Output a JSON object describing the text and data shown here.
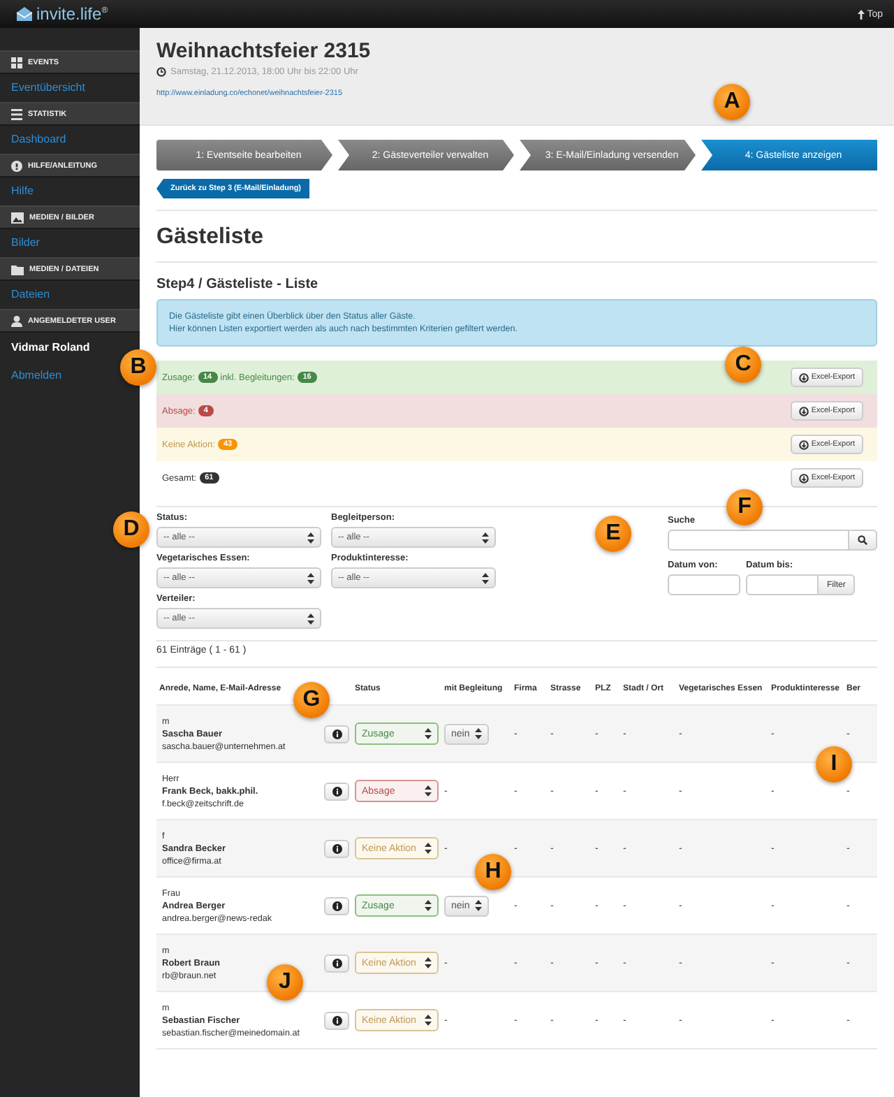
{
  "topbar": {
    "logo": "invite.life",
    "logo_mark": "®",
    "top_link": "Top"
  },
  "sidebar": [
    {
      "title": "EVENTS",
      "items": [
        {
          "label": "Eventübersicht",
          "kind": "link"
        }
      ]
    },
    {
      "title": "STATISTIK",
      "items": [
        {
          "label": "Dashboard",
          "kind": "link"
        }
      ]
    },
    {
      "title": "HILFE/ANLEITUNG",
      "items": [
        {
          "label": "Hilfe",
          "kind": "link"
        }
      ]
    },
    {
      "title": "MEDIEN / BILDER",
      "items": [
        {
          "label": "Bilder",
          "kind": "link"
        }
      ]
    },
    {
      "title": "MEDIEN / DATEIEN",
      "items": [
        {
          "label": "Dateien",
          "kind": "link"
        }
      ]
    },
    {
      "title": "ANGEMELDETER USER",
      "items": [
        {
          "label": "Vidmar Roland",
          "kind": "user"
        },
        {
          "label": "Abmelden",
          "kind": "link"
        }
      ]
    }
  ],
  "event": {
    "title": "Weihnachtsfeier 2315",
    "date": "Samstag, 21.12.2013, 18:00 Uhr bis 22:00 Uhr",
    "url": "http://www.einladung.co/echonet/weihnachtsfeier-2315"
  },
  "steps": [
    {
      "label": "1: Eventseite bearbeiten",
      "selected": false
    },
    {
      "label": "2: Gästeverteiler verwalten",
      "selected": false
    },
    {
      "label": "3: E-Mail/Einladung versenden",
      "selected": false
    },
    {
      "label": "4: Gästeliste anzeigen",
      "selected": true
    }
  ],
  "back_button": "Zurück zu Step 3 (E-Mail/Einladung)",
  "page_title": "Gästeliste",
  "section_title": "Step4 / Gästeliste - Liste",
  "info": [
    "Die Gästeliste gibt einen Überblick über den Status aller Gäste.",
    "Hier können Listen exportiert werden als auch nach bestimmten Kriterien gefiltert werden."
  ],
  "summary": [
    {
      "kind": "zusage",
      "parts": [
        {
          "label": "Zusage:",
          "count": "14"
        },
        {
          "label": "inkl. Begleitungen:",
          "count": "16"
        }
      ],
      "button": "Excel-Export"
    },
    {
      "kind": "absage",
      "parts": [
        {
          "label": "Absage:",
          "count": "4"
        }
      ],
      "button": "Excel-Export"
    },
    {
      "kind": "keine",
      "parts": [
        {
          "label": "Keine Aktion:",
          "count": "43"
        }
      ],
      "button": "Excel-Export"
    },
    {
      "kind": "gesamt",
      "parts": [
        {
          "label": "Gesamt:",
          "count": "61"
        }
      ],
      "button": "Excel-Export"
    }
  ],
  "filters": [
    {
      "label": "Status:",
      "value": "-- alle --"
    },
    {
      "label": "Begleitperson:",
      "value": "-- alle --"
    },
    {
      "label": "Vegetarisches Essen:",
      "value": "-- alle --"
    },
    {
      "label": "Produktinteresse:",
      "value": "-- alle --"
    },
    {
      "label": "Verteiler:",
      "value": "-- alle --"
    }
  ],
  "search": {
    "label": "Suche",
    "date_from": "Datum von:",
    "date_to": "Datum bis:",
    "filter_button": "Filter"
  },
  "count": "61 Einträge ( 1 - 61 )",
  "table": {
    "columns": [
      "Anrede, Name, E-Mail-Adresse",
      "Status",
      "mit Begleitung",
      "Firma",
      "Strasse",
      "PLZ",
      "Stadt / Ort",
      "Vegetarisches Essen",
      "Produktinteresse",
      "Ber"
    ],
    "rows": [
      {
        "cells": [
          {
            "salutation": "m",
            "name": "Sascha Bauer",
            "email": "sascha.bauer@unternehmen.at"
          },
          {
            "kind": "zusage",
            "value": "Zusage"
          },
          {
            "kind": "select",
            "value": "nein"
          },
          "-",
          "-",
          "-",
          "-",
          "-",
          "-",
          "-"
        ]
      },
      {
        "cells": [
          {
            "salutation": "Herr",
            "name": "Frank Beck, bakk.phil.",
            "email": "f.beck@zeitschrift.de"
          },
          {
            "kind": "absage",
            "value": "Absage"
          },
          {
            "kind": "text",
            "value": "-"
          },
          "-",
          "-",
          "-",
          "-",
          "-",
          "-",
          "-"
        ]
      },
      {
        "cells": [
          {
            "salutation": "f",
            "name": "Sandra Becker",
            "email": "office@firma.at"
          },
          {
            "kind": "keine",
            "value": "Keine Aktion"
          },
          {
            "kind": "text",
            "value": "-"
          },
          "-",
          "-",
          "-",
          "-",
          "-",
          "-",
          "-"
        ]
      },
      {
        "cells": [
          {
            "salutation": "Frau",
            "name": "Andrea Berger",
            "email": "andrea.berger@news-redak"
          },
          {
            "kind": "zusage",
            "value": "Zusage"
          },
          {
            "kind": "select",
            "value": "nein"
          },
          "-",
          "-",
          "-",
          "-",
          "-",
          "-",
          "-"
        ]
      },
      {
        "cells": [
          {
            "salutation": "m",
            "name": "Robert Braun",
            "email": "rb@braun.net"
          },
          {
            "kind": "keine",
            "value": "Keine Aktion"
          },
          {
            "kind": "text",
            "value": "-"
          },
          "-",
          "-",
          "-",
          "-",
          "-",
          "-",
          "-"
        ]
      },
      {
        "cells": [
          {
            "salutation": "m",
            "name": "Sebastian Fischer",
            "email": "sebastian.fischer@meinedomain.at"
          },
          {
            "kind": "keine",
            "value": "Keine Aktion"
          },
          {
            "kind": "text",
            "value": "-"
          },
          "-",
          "-",
          "-",
          "-",
          "-",
          "-",
          "-"
        ]
      }
    ]
  },
  "callouts": [
    "A",
    "B",
    "C",
    "D",
    "E",
    "F",
    "G",
    "H",
    "I",
    "J"
  ]
}
